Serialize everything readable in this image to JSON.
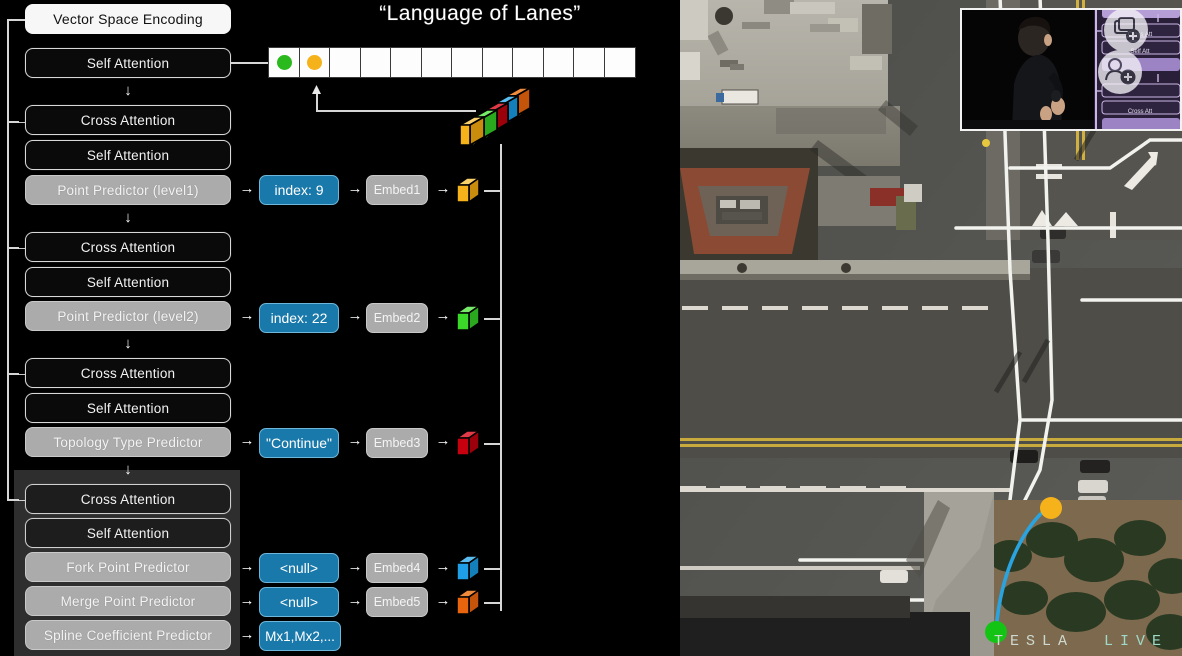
{
  "slide": {
    "title": "“Language of Lanes”"
  },
  "diagram": {
    "top_box": {
      "label": "Vector Space Encoding"
    },
    "blocks": [
      {
        "label": "Self Attention",
        "kind": "attn"
      },
      {
        "label": "Cross Attention",
        "kind": "attn"
      },
      {
        "label": "Self Attention",
        "kind": "attn"
      },
      {
        "label": "Point Predictor (level1)",
        "kind": "pred"
      },
      {
        "label": "Cross Attention",
        "kind": "attn"
      },
      {
        "label": "Self Attention",
        "kind": "attn"
      },
      {
        "label": "Point Predictor (level2)",
        "kind": "pred"
      },
      {
        "label": "Cross Attention",
        "kind": "attn"
      },
      {
        "label": "Self Attention",
        "kind": "attn"
      },
      {
        "label": "Topology Type Predictor",
        "kind": "pred"
      },
      {
        "label": "Cross Attention",
        "kind": "attn"
      },
      {
        "label": "Self Attention",
        "kind": "attn"
      },
      {
        "label": "Fork Point Predictor",
        "kind": "pred"
      },
      {
        "label": "Merge Point Predictor",
        "kind": "pred"
      },
      {
        "label": "Spline Coefficient Predictor",
        "kind": "pred"
      }
    ],
    "outputs": [
      {
        "value": "index: 9",
        "embed": "Embed1",
        "cube_color": "#f5b21a"
      },
      {
        "value": "index: 22",
        "embed": "Embed2",
        "cube_color": "#3bd82a"
      },
      {
        "value": "\"Continue\"",
        "embed": "Embed3",
        "cube_color": "#c7000f"
      },
      {
        "value": "<null>",
        "embed": "Embed4",
        "cube_color": "#1e9fe8"
      },
      {
        "value": "<null>",
        "embed": "Embed5",
        "cube_color": "#e8650d"
      },
      {
        "value": "Mx1,Mx2,...",
        "embed": null,
        "cube_color": null
      }
    ],
    "token_strip": {
      "cell_count": 12,
      "filled": [
        {
          "index": 0,
          "color": "#2aba1e"
        },
        {
          "index": 1,
          "color": "#f5b21a"
        }
      ]
    },
    "token_stack_colors": [
      "#f5b21a",
      "#3bd82a",
      "#c7000f",
      "#1e9fe8",
      "#e8650d"
    ],
    "arrow_right_glyph": "→",
    "arrow_down_glyph": "↓",
    "colors": {
      "pill_blue": "#1a79ab",
      "predictor_grey": "#ababab",
      "attention_black": "#0a0a0a",
      "panel_grey": "#2e2e2e",
      "line": "#d6d6d6"
    }
  },
  "aerial": {
    "watermark_brand": "TESLA",
    "watermark_live": "LIVE",
    "markers": {
      "start_point_color": "#14c414",
      "end_point_color": "#f5b21a",
      "spline_color": "#2aa4e0"
    }
  },
  "pip": {
    "label": "presenter-on-stage-video"
  }
}
